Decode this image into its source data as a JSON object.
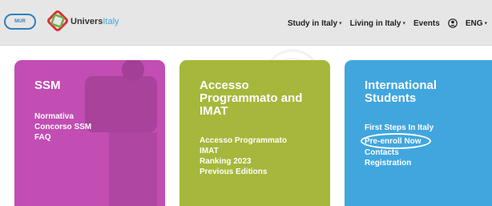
{
  "header": {
    "mur_logo_text": "MUR",
    "brand": {
      "dark": "Univers",
      "light": "Italy"
    },
    "nav": [
      {
        "label": "Study in Italy",
        "has_dropdown": true
      },
      {
        "label": "Living in Italy",
        "has_dropdown": true
      },
      {
        "label": "Events",
        "has_dropdown": false
      }
    ],
    "language": {
      "label": "ENG",
      "has_dropdown": true
    },
    "dropdown_glyph": "▾"
  },
  "cards": {
    "ssm": {
      "title": "SSM",
      "color": "#c24db3",
      "links": [
        "Normativa",
        "Concorso SSM",
        "FAQ"
      ]
    },
    "imat": {
      "title": "Accesso Programmato and IMAT",
      "color": "#a6b73b",
      "links": [
        "Accesso Programmato",
        "IMAT",
        "Ranking 2023",
        "Previous Editions"
      ]
    },
    "intl": {
      "title": "International Students",
      "color": "#41a6de",
      "links": [
        "First Steps In Italy",
        "Pre-enroll Now",
        "Contacts",
        "Registration"
      ]
    }
  },
  "icons": {
    "user": "user-icon",
    "mur_logo": "mur-logo-icon",
    "brand_logo": "universitaly-logo-icon"
  }
}
